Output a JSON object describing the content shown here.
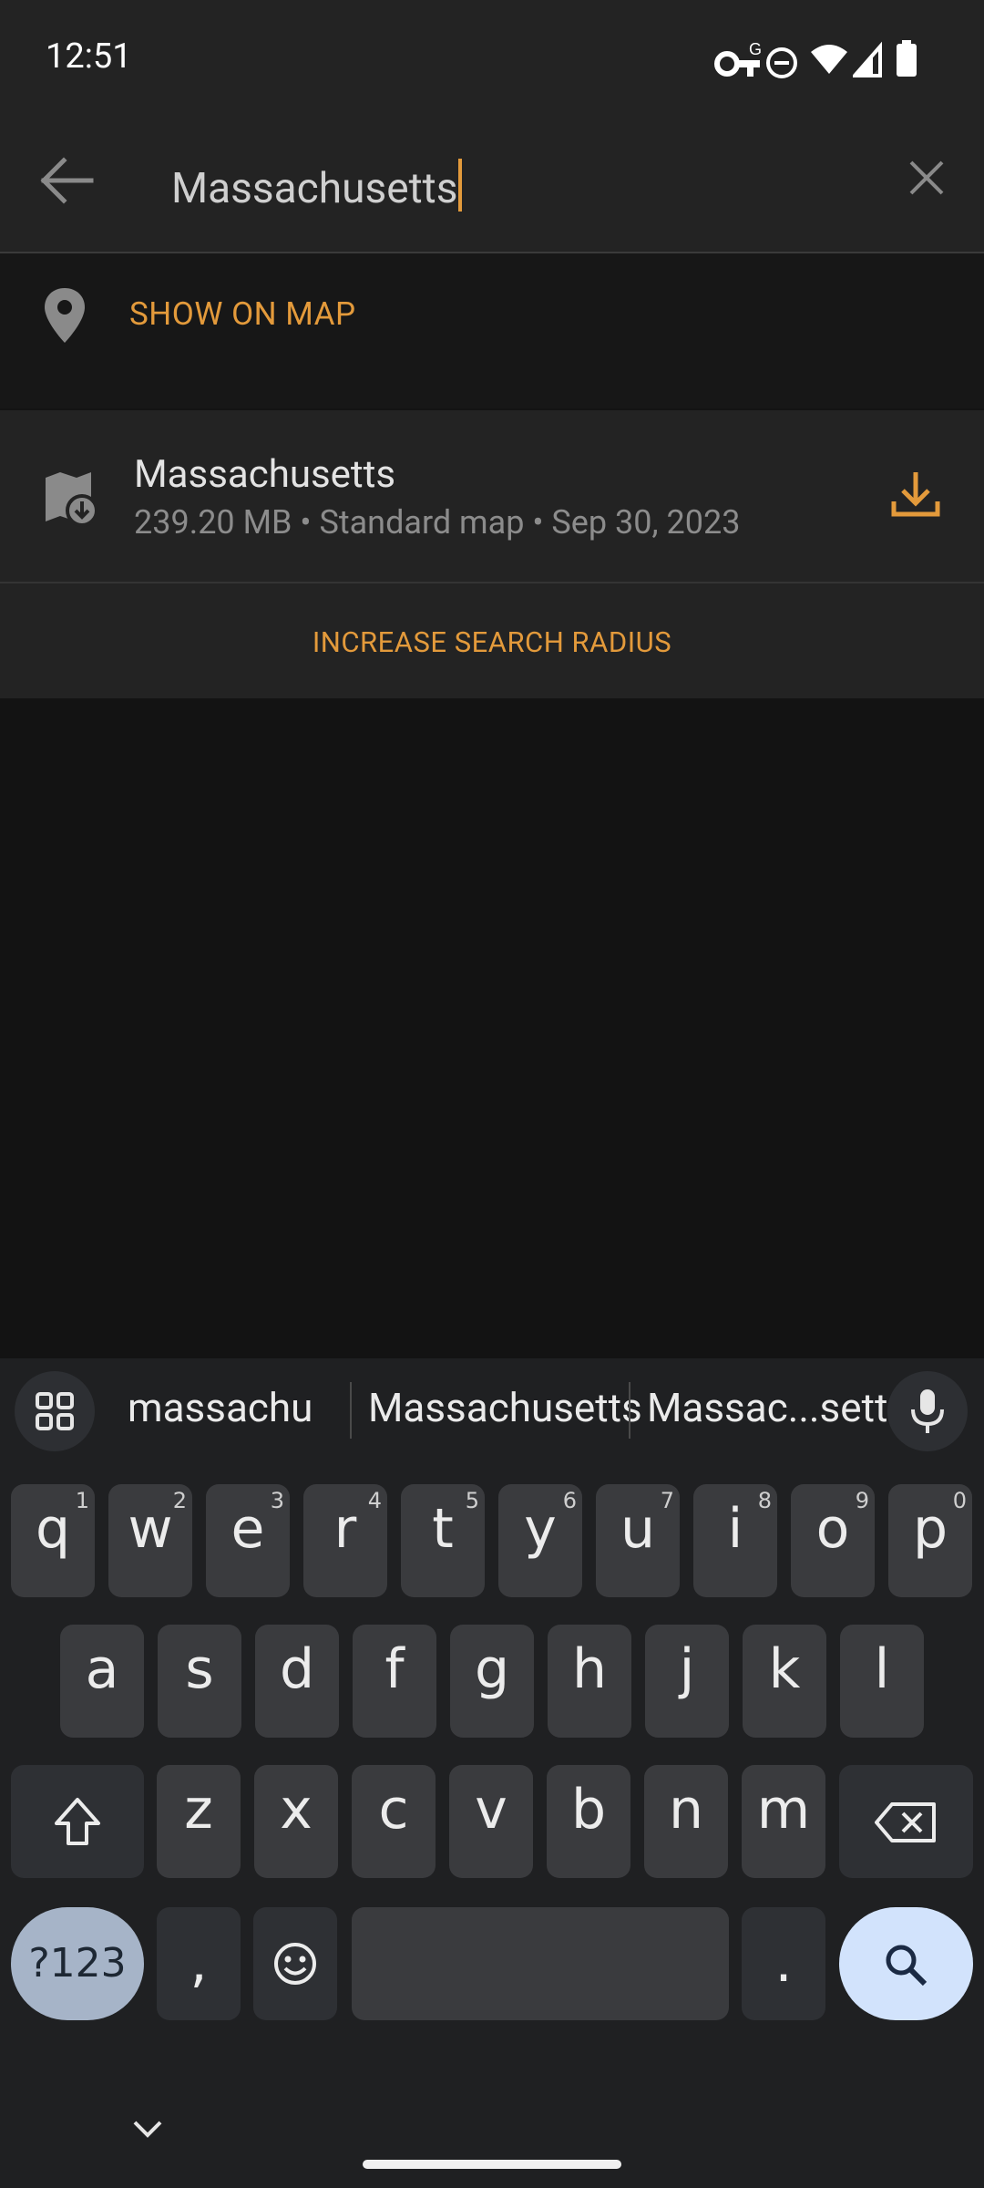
{
  "status_bar": {
    "time": "12:51",
    "icons": [
      "vpn-key-icon",
      "do-not-disturb-icon",
      "wifi-icon",
      "cell-signal-icon",
      "battery-icon"
    ]
  },
  "search": {
    "query": "Massachusetts",
    "back_icon": "arrow-back-icon",
    "clear_icon": "close-icon"
  },
  "show_on_map": {
    "label": "SHOW ON MAP",
    "icon": "map-pin-icon"
  },
  "results": [
    {
      "title": "Massachusetts",
      "meta": "239.20 MB • Standard map • Sep 30, 2023",
      "icon": "map-download-icon",
      "action_icon": "download-icon"
    }
  ],
  "increase_radius": {
    "label": "INCREASE SEARCH RADIUS"
  },
  "keyboard": {
    "suggestions": [
      "massachu",
      "Massachusetts",
      "Massac...settes"
    ],
    "row1": [
      {
        "k": "q",
        "h": "1"
      },
      {
        "k": "w",
        "h": "2"
      },
      {
        "k": "e",
        "h": "3"
      },
      {
        "k": "r",
        "h": "4"
      },
      {
        "k": "t",
        "h": "5"
      },
      {
        "k": "y",
        "h": "6"
      },
      {
        "k": "u",
        "h": "7"
      },
      {
        "k": "i",
        "h": "8"
      },
      {
        "k": "o",
        "h": "9"
      },
      {
        "k": "p",
        "h": "0"
      }
    ],
    "row2": [
      "a",
      "s",
      "d",
      "f",
      "g",
      "h",
      "j",
      "k",
      "l"
    ],
    "row3": [
      "z",
      "x",
      "c",
      "v",
      "b",
      "n",
      "m"
    ],
    "symbols_label": "?123",
    "comma": ",",
    "period": "."
  },
  "colors": {
    "accent": "#e39a3b",
    "surface": "#232323",
    "background": "#131313",
    "keyboard": "#1f2022",
    "key": "#3a3b3e",
    "search_key": "#d2e3fc"
  }
}
